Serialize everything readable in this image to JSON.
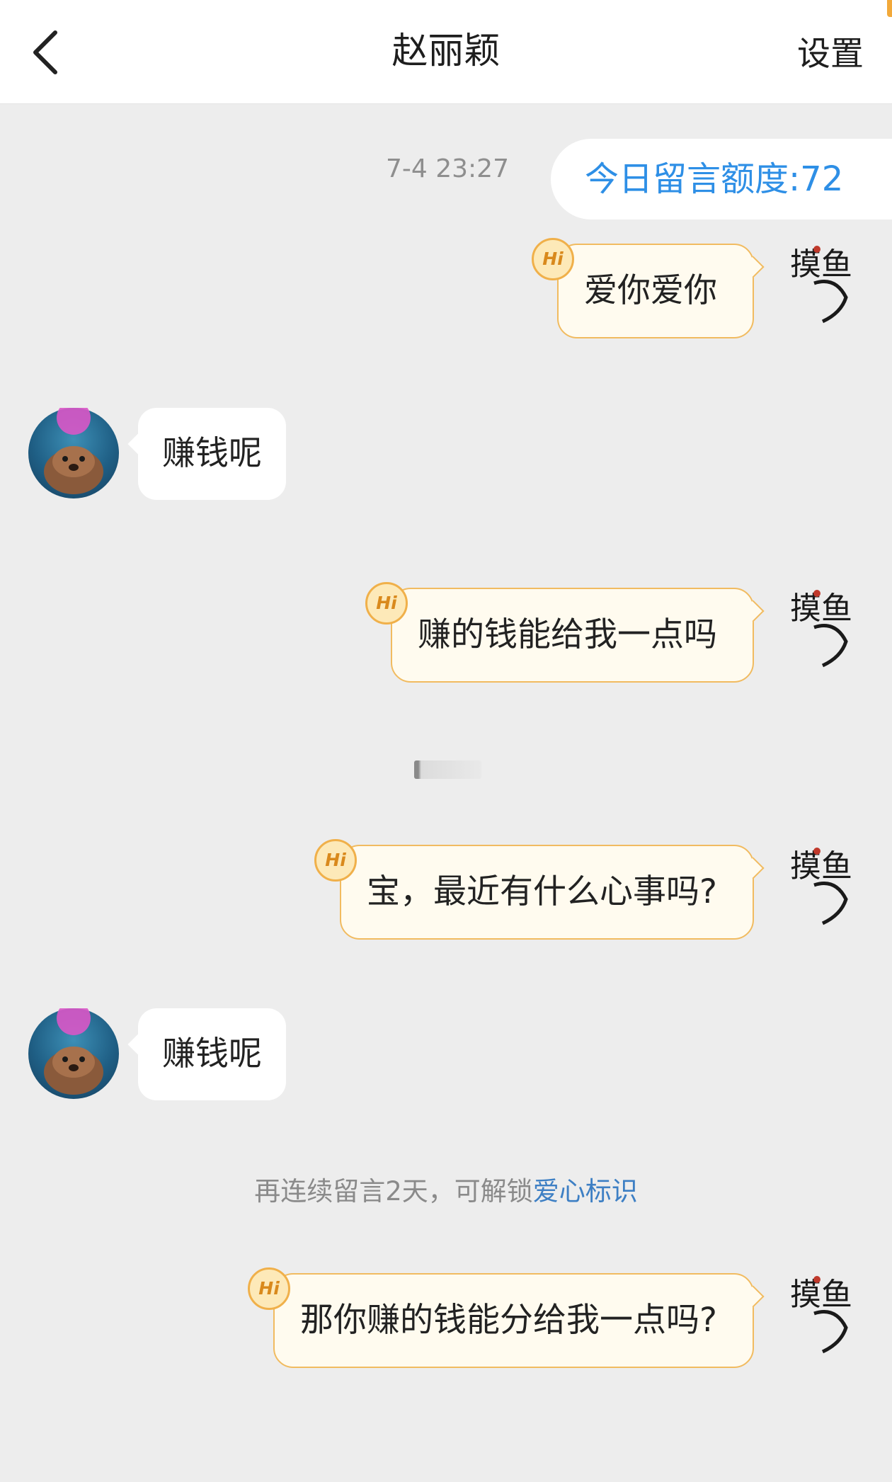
{
  "header": {
    "title": "赵丽颖",
    "settings_label": "设置"
  },
  "top": {
    "timestamp": "7-4 23:27",
    "quota_label": "今日留言额度:72"
  },
  "my_avatar_text": "摸鱼",
  "messages": [
    {
      "sender": "me",
      "text": "爱你爱你",
      "badge": "Hi"
    },
    {
      "sender": "other",
      "text": "赚钱呢"
    },
    {
      "sender": "me",
      "text": "赚的钱能给我一点吗",
      "badge": "Hi"
    },
    {
      "sender": "me",
      "text": "宝，最近有什么心事吗?",
      "badge": "Hi"
    },
    {
      "sender": "other",
      "text": "赚钱呢"
    },
    {
      "sender": "me",
      "text": "那你赚的钱能分给我一点吗?",
      "badge": "Hi"
    }
  ],
  "notice": {
    "text": "再连续留言2天，可解锁",
    "link": "爱心标识"
  },
  "colors": {
    "accent_blue": "#2e8fe6",
    "bubble_border": "#f1bb60",
    "bubble_fill": "#fffbef",
    "background": "#ededed"
  }
}
